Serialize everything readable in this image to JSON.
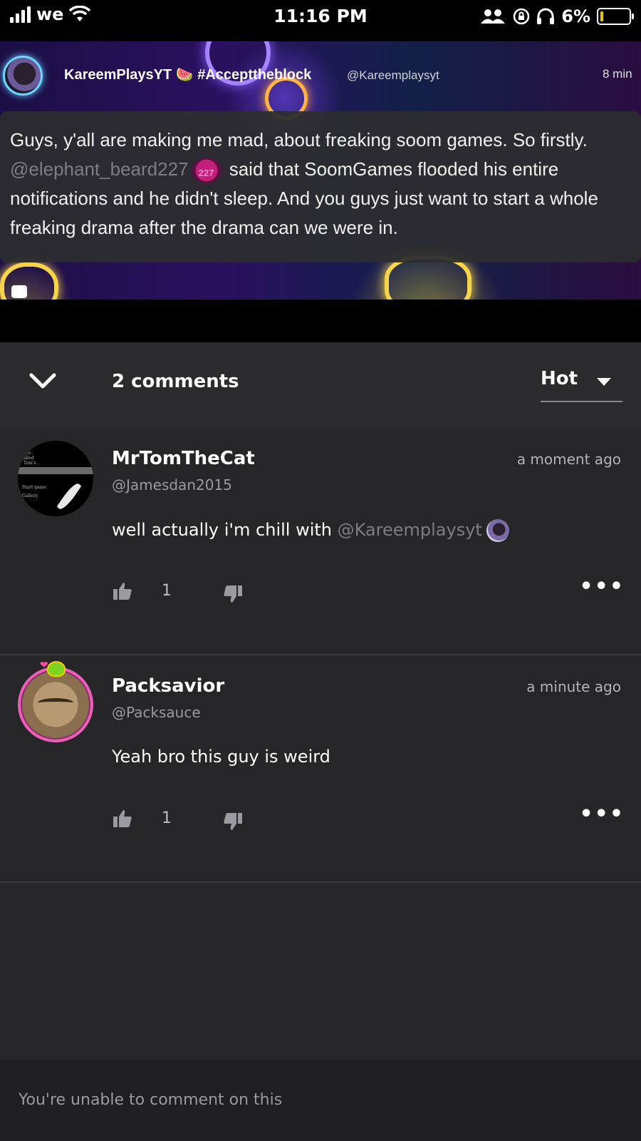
{
  "status_bar": {
    "carrier": "we",
    "time": "11:16 PM",
    "battery": "6%"
  },
  "post": {
    "author_name": "KareemPlaysYT 🍉 #Accepttheblock",
    "author_handle": "@Kareemplaysyt",
    "time": "8 min",
    "text_part1": "Guys, y'all are making me mad, about freaking soom games. So firstly. ",
    "mention": "@elephant_beard227",
    "mention_avatar_label": "227",
    "text_part2": " said that SoomGames flooded his entire notifications and he didn't sleep. And you guys just want to start a whole freaking drama after the drama can we were in."
  },
  "comments_header": {
    "count_label": "2 comments",
    "sort_label": "Hot"
  },
  "comments": [
    {
      "name": "MrTomTheCat",
      "handle": "@Jamesdan2015",
      "time": "a moment ago",
      "text": "well actually i'm chill with ",
      "mention": "@Kareemplaysyt",
      "likes": "1"
    },
    {
      "name": "Packsavior",
      "handle": "@Packsauce",
      "time": "a minute ago",
      "text": "Yeah bro this guy is weird",
      "likes": "1"
    }
  ],
  "footer": {
    "message": "You're unable to comment on this"
  },
  "icons": [
    "signal-icon",
    "wifi-icon",
    "people-icon",
    "rotation-lock-icon",
    "headphones-icon",
    "battery-icon",
    "chevron-down-icon",
    "caret-down-icon",
    "thumbs-up-icon",
    "thumbs-down-icon",
    "more-icon",
    "comment-icon"
  ]
}
